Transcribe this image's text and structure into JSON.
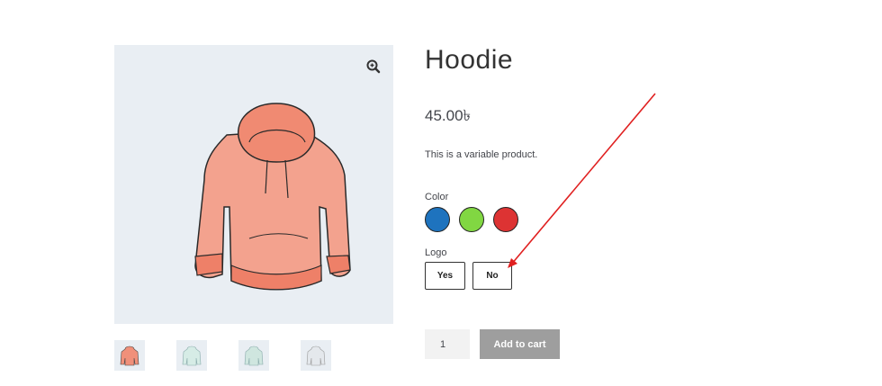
{
  "product": {
    "title": "Hoodie",
    "price": "45.00৳",
    "description": "This is a variable product."
  },
  "attributes": {
    "color": {
      "label": "Color",
      "swatches": [
        {
          "name": "blue",
          "hex": "#1e73be"
        },
        {
          "name": "green",
          "hex": "#81d742"
        },
        {
          "name": "red",
          "hex": "#dd3333"
        }
      ]
    },
    "logo": {
      "label": "Logo",
      "options": [
        "Yes",
        "No"
      ]
    }
  },
  "cart": {
    "quantity": "1",
    "add_label": "Add to cart"
  },
  "gallery": {
    "zoom_icon": "zoom-in-icon",
    "thumbnails": [
      "hoodie-pink",
      "hoodie-mint-1",
      "hoodie-mint-2",
      "hoodie-grey"
    ]
  },
  "colors": {
    "gallery_bg": "#e9eef3",
    "hoodie_fill": "#f09a84",
    "annotation_arrow": "#e02020"
  }
}
